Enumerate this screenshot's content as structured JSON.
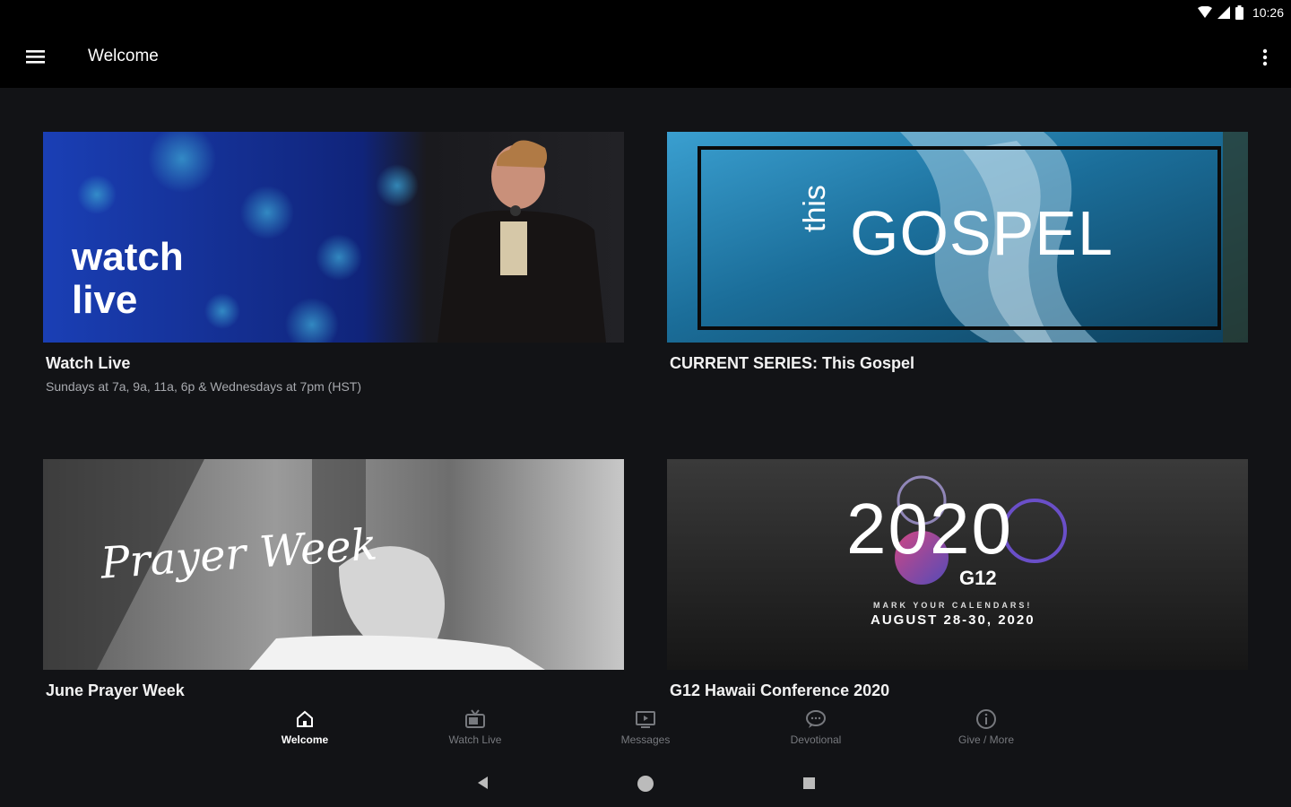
{
  "status": {
    "time": "10:26"
  },
  "appbar": {
    "title": "Welcome"
  },
  "cards": [
    {
      "title": "Watch Live",
      "subtitle": "Sundays at 7a, 9a, 11a, 6p & Wednesdays at 7pm (HST)",
      "image_text_line1": "watch",
      "image_text_line2": "live"
    },
    {
      "title": "CURRENT SERIES:  This Gospel",
      "image_text_small": "this",
      "image_text_large": "GOSPEL"
    },
    {
      "title": "June Prayer Week",
      "image_text": "Prayer Week"
    },
    {
      "title": "G12 Hawaii Conference 2020",
      "image_year": "2020",
      "image_line1": "MARK YOUR CALENDARS!",
      "image_line2": "AUGUST 28-30, 2020",
      "image_logo": "G12"
    }
  ],
  "bottom_nav": [
    {
      "label": "Welcome",
      "icon": "home-icon",
      "active": true
    },
    {
      "label": "Watch Live",
      "icon": "tv-icon"
    },
    {
      "label": "Messages",
      "icon": "monitor-play-icon"
    },
    {
      "label": "Devotional",
      "icon": "chat-bubble-icon"
    },
    {
      "label": "Give / More",
      "icon": "info-icon"
    }
  ],
  "colors": {
    "background": "#121316",
    "appbar": "#000000",
    "inactive_nav": "#77797e"
  }
}
